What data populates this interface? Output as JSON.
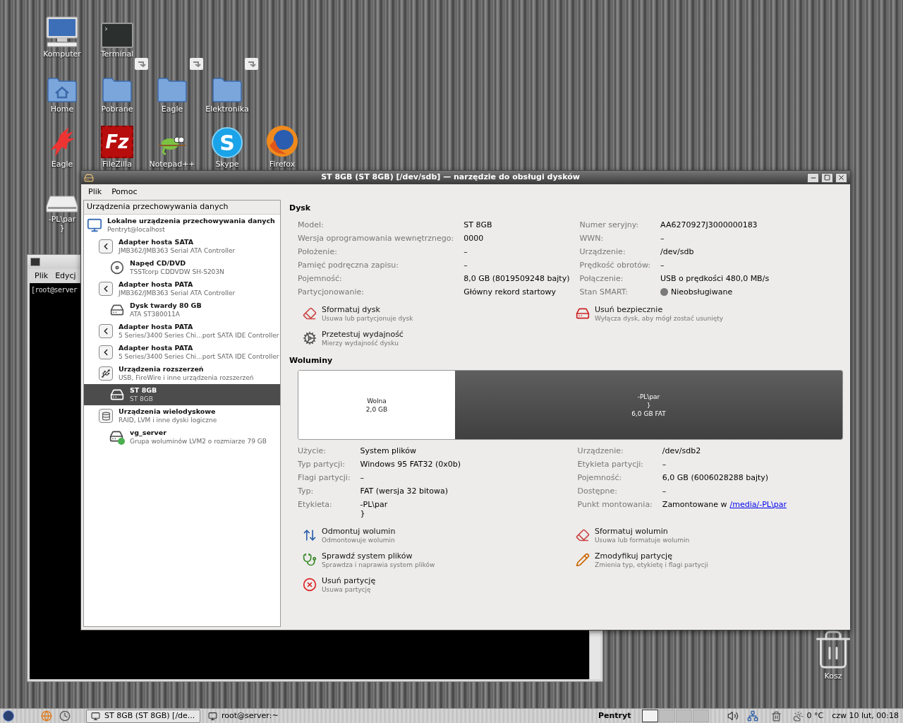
{
  "desktop": {
    "icon_rows": [
      [
        {
          "kind": "computer",
          "label": "Komputer"
        },
        {
          "kind": "terminal",
          "label": "Terminal"
        }
      ],
      [
        {
          "kind": "home",
          "label": "Home"
        },
        {
          "kind": "folder-link",
          "label": "Pobrane"
        },
        {
          "kind": "folder-link",
          "label": "Eagle"
        },
        {
          "kind": "folder-link",
          "label": "Elektronika"
        }
      ],
      [
        {
          "kind": "bird",
          "label": "Eagle"
        },
        {
          "kind": "filezilla",
          "label": "FileZilla",
          "glyph": "Fz"
        },
        {
          "kind": "chameleon",
          "label": "Notepad++"
        },
        {
          "kind": "skype",
          "label": "Skype",
          "glyph": "S"
        },
        {
          "kind": "firefox",
          "label": "Firefox"
        }
      ],
      [
        {
          "kind": "drive",
          "label": "-PL\\par\n}"
        }
      ]
    ],
    "trash": {
      "label": "Kosz"
    }
  },
  "terminal_window": {
    "menu": [
      "Plik",
      "Edycj"
    ],
    "prompt": "[root@server"
  },
  "main_window": {
    "title": "ST 8GB (ST 8GB) [/dev/sdb] — narzędzie do obsługi dysków",
    "menu": [
      "Plik",
      "Pomoc"
    ],
    "sidebar": {
      "header": "Urządzenia przechowywania danych",
      "items": [
        {
          "kind": "computer",
          "title": "Lokalne urządzenia przechowywania danych",
          "subtitle": "Pentryt@localhost",
          "selected": false,
          "children": [
            {
              "kind": "adapter",
              "title": "Adapter hosta SATA",
              "subtitle": "JMB362/JMB363 Serial ATA Controller",
              "selected": false,
              "children": [
                {
                  "kind": "optical",
                  "title": "Napęd CD/DVD",
                  "subtitle": "TSSTcorp CDDVDW SH-S203N",
                  "selected": false
                }
              ]
            },
            {
              "kind": "adapter",
              "title": "Adapter hosta PATA",
              "subtitle": "JMB362/JMB363 Serial ATA Controller",
              "selected": false,
              "children": [
                {
                  "kind": "disk",
                  "title": "Dysk twardy 80 GB",
                  "subtitle": "ATA ST380011A",
                  "selected": false
                }
              ]
            },
            {
              "kind": "adapter",
              "title": "Adapter hosta PATA",
              "subtitle": "5 Series/3400 Series Chi...port SATA IDE Controller",
              "selected": false
            },
            {
              "kind": "adapter",
              "title": "Adapter hosta PATA",
              "subtitle": "5 Series/3400 Series Chi...port SATA IDE Controller",
              "selected": false
            },
            {
              "kind": "usb",
              "title": "Urządzenia rozszerzeń",
              "subtitle": "USB, FireWire i inne urządzenia rozszerzeń",
              "selected": false,
              "children": [
                {
                  "kind": "drive",
                  "title": "ST 8GB",
                  "subtitle": "ST 8GB",
                  "selected": true
                }
              ]
            },
            {
              "kind": "multidisk",
              "title": "Urządzenia wielodyskowe",
              "subtitle": "RAID, LVM i inne dyski logiczne",
              "selected": false,
              "children": [
                {
                  "kind": "lvm",
                  "title": "vg_server",
                  "subtitle": "Grupa woluminów LVM2 o rozmiarze 79 GB",
                  "selected": false
                }
              ]
            }
          ]
        }
      ]
    },
    "drive": {
      "heading": "Dysk",
      "rows": [
        [
          {
            "kind": "text",
            "label": "Model:",
            "value": "ST 8GB"
          },
          {
            "kind": "text",
            "label": "Numer seryjny:",
            "value": "AA6270927J3000000183"
          }
        ],
        [
          {
            "kind": "text",
            "label": "Wersja oprogramowania wewnętrznego:",
            "value": "0000"
          },
          {
            "kind": "text",
            "label": "WWN:",
            "value": "–"
          }
        ],
        [
          {
            "kind": "text",
            "label": "Położenie:",
            "value": "–"
          },
          {
            "kind": "text",
            "label": "Urządzenie:",
            "value": "/dev/sdb"
          }
        ],
        [
          {
            "kind": "text",
            "label": "Pamięć podręczna zapisu:",
            "value": "–"
          },
          {
            "kind": "text",
            "label": "Prędkość obrotów:",
            "value": "–"
          }
        ],
        [
          {
            "kind": "text",
            "label": "Pojemność:",
            "value": "8,0 GB (8019509248 bajty)"
          },
          {
            "kind": "text",
            "label": "Połączenie:",
            "value": "USB o prędkości 480,0 MB/s"
          }
        ],
        [
          {
            "kind": "text",
            "label": "Partycjonowanie:",
            "value": "Główny rekord startowy"
          },
          {
            "kind": "status",
            "label": "Stan SMART:",
            "value": "Nieobsługiwane"
          }
        ]
      ],
      "actions": [
        {
          "kind": "format",
          "title": "Sformatuj dysk",
          "description": "Usuwa lub partycjonuje dysk"
        },
        {
          "kind": "eject",
          "title": "Usuń bezpiecznie",
          "description": "Wyłącza dysk, aby mógł zostać usunięty"
        },
        {
          "kind": "benchmark",
          "title": "Przetestuj wydajność",
          "description": "Mierzy wydajność dysku"
        }
      ]
    },
    "volumes": {
      "heading": "Woluminy",
      "segments": [
        {
          "kind": "free",
          "selected": false,
          "text": "Wolna\n2,0 GB"
        },
        {
          "kind": "partition",
          "selected": true,
          "text": "-PL\\par\n}\n6,0 GB FAT"
        }
      ],
      "rows": [
        [
          {
            "kind": "text",
            "label": "Użycie:",
            "value": "System plików"
          },
          {
            "kind": "text",
            "label": "Urządzenie:",
            "value": "/dev/sdb2"
          }
        ],
        [
          {
            "kind": "text",
            "label": "Typ partycji:",
            "value": "Windows 95 FAT32 (0x0b)"
          },
          {
            "kind": "text",
            "label": "Etykieta partycji:",
            "value": "–"
          }
        ],
        [
          {
            "kind": "text",
            "label": "Flagi partycji:",
            "value": "–"
          },
          {
            "kind": "text",
            "label": "Pojemność:",
            "value": "6,0 GB (6006028288 bajty)"
          }
        ],
        [
          {
            "kind": "text",
            "label": "Typ:",
            "value": "FAT (wersja 32 bitowa)"
          },
          {
            "kind": "text",
            "label": "Dostępne:",
            "value": "–"
          }
        ],
        [
          {
            "kind": "text",
            "label": "Etykieta:",
            "value": "-PL\\par\n}"
          },
          {
            "kind": "link",
            "label": "Punkt montowania:",
            "value": "Zamontowane w",
            "link": "/media/-PL\\par"
          }
        ]
      ],
      "actions": [
        {
          "kind": "unmount",
          "title": "Odmontuj wolumin",
          "description": "Odmontowuje wolumin"
        },
        {
          "kind": "format",
          "title": "Sformatuj wolumin",
          "description": "Usuwa lub formatuje wolumin"
        },
        {
          "kind": "check",
          "title": "Sprawdź system plików",
          "description": "Sprawdza i naprawia system plików"
        },
        {
          "kind": "edit",
          "title": "Zmodyfikuj partycję",
          "description": "Zmienia typ, etykietę i flagi partycji"
        },
        {
          "kind": "delete",
          "title": "Usuń partycję",
          "description": "Usuwa partycję"
        }
      ]
    }
  },
  "taskbar": {
    "tasks": [
      {
        "label": "ST 8GB (ST 8GB) [/de...",
        "selected": true
      },
      {
        "label": "root@server:~",
        "selected": false
      }
    ],
    "user": "Pentryt",
    "workspaces": [
      {
        "selected": true
      },
      {
        "selected": false
      },
      {
        "selected": false
      },
      {
        "selected": false
      }
    ],
    "weather": "0 °C",
    "clock": "czw 10 lut, 00:18"
  }
}
